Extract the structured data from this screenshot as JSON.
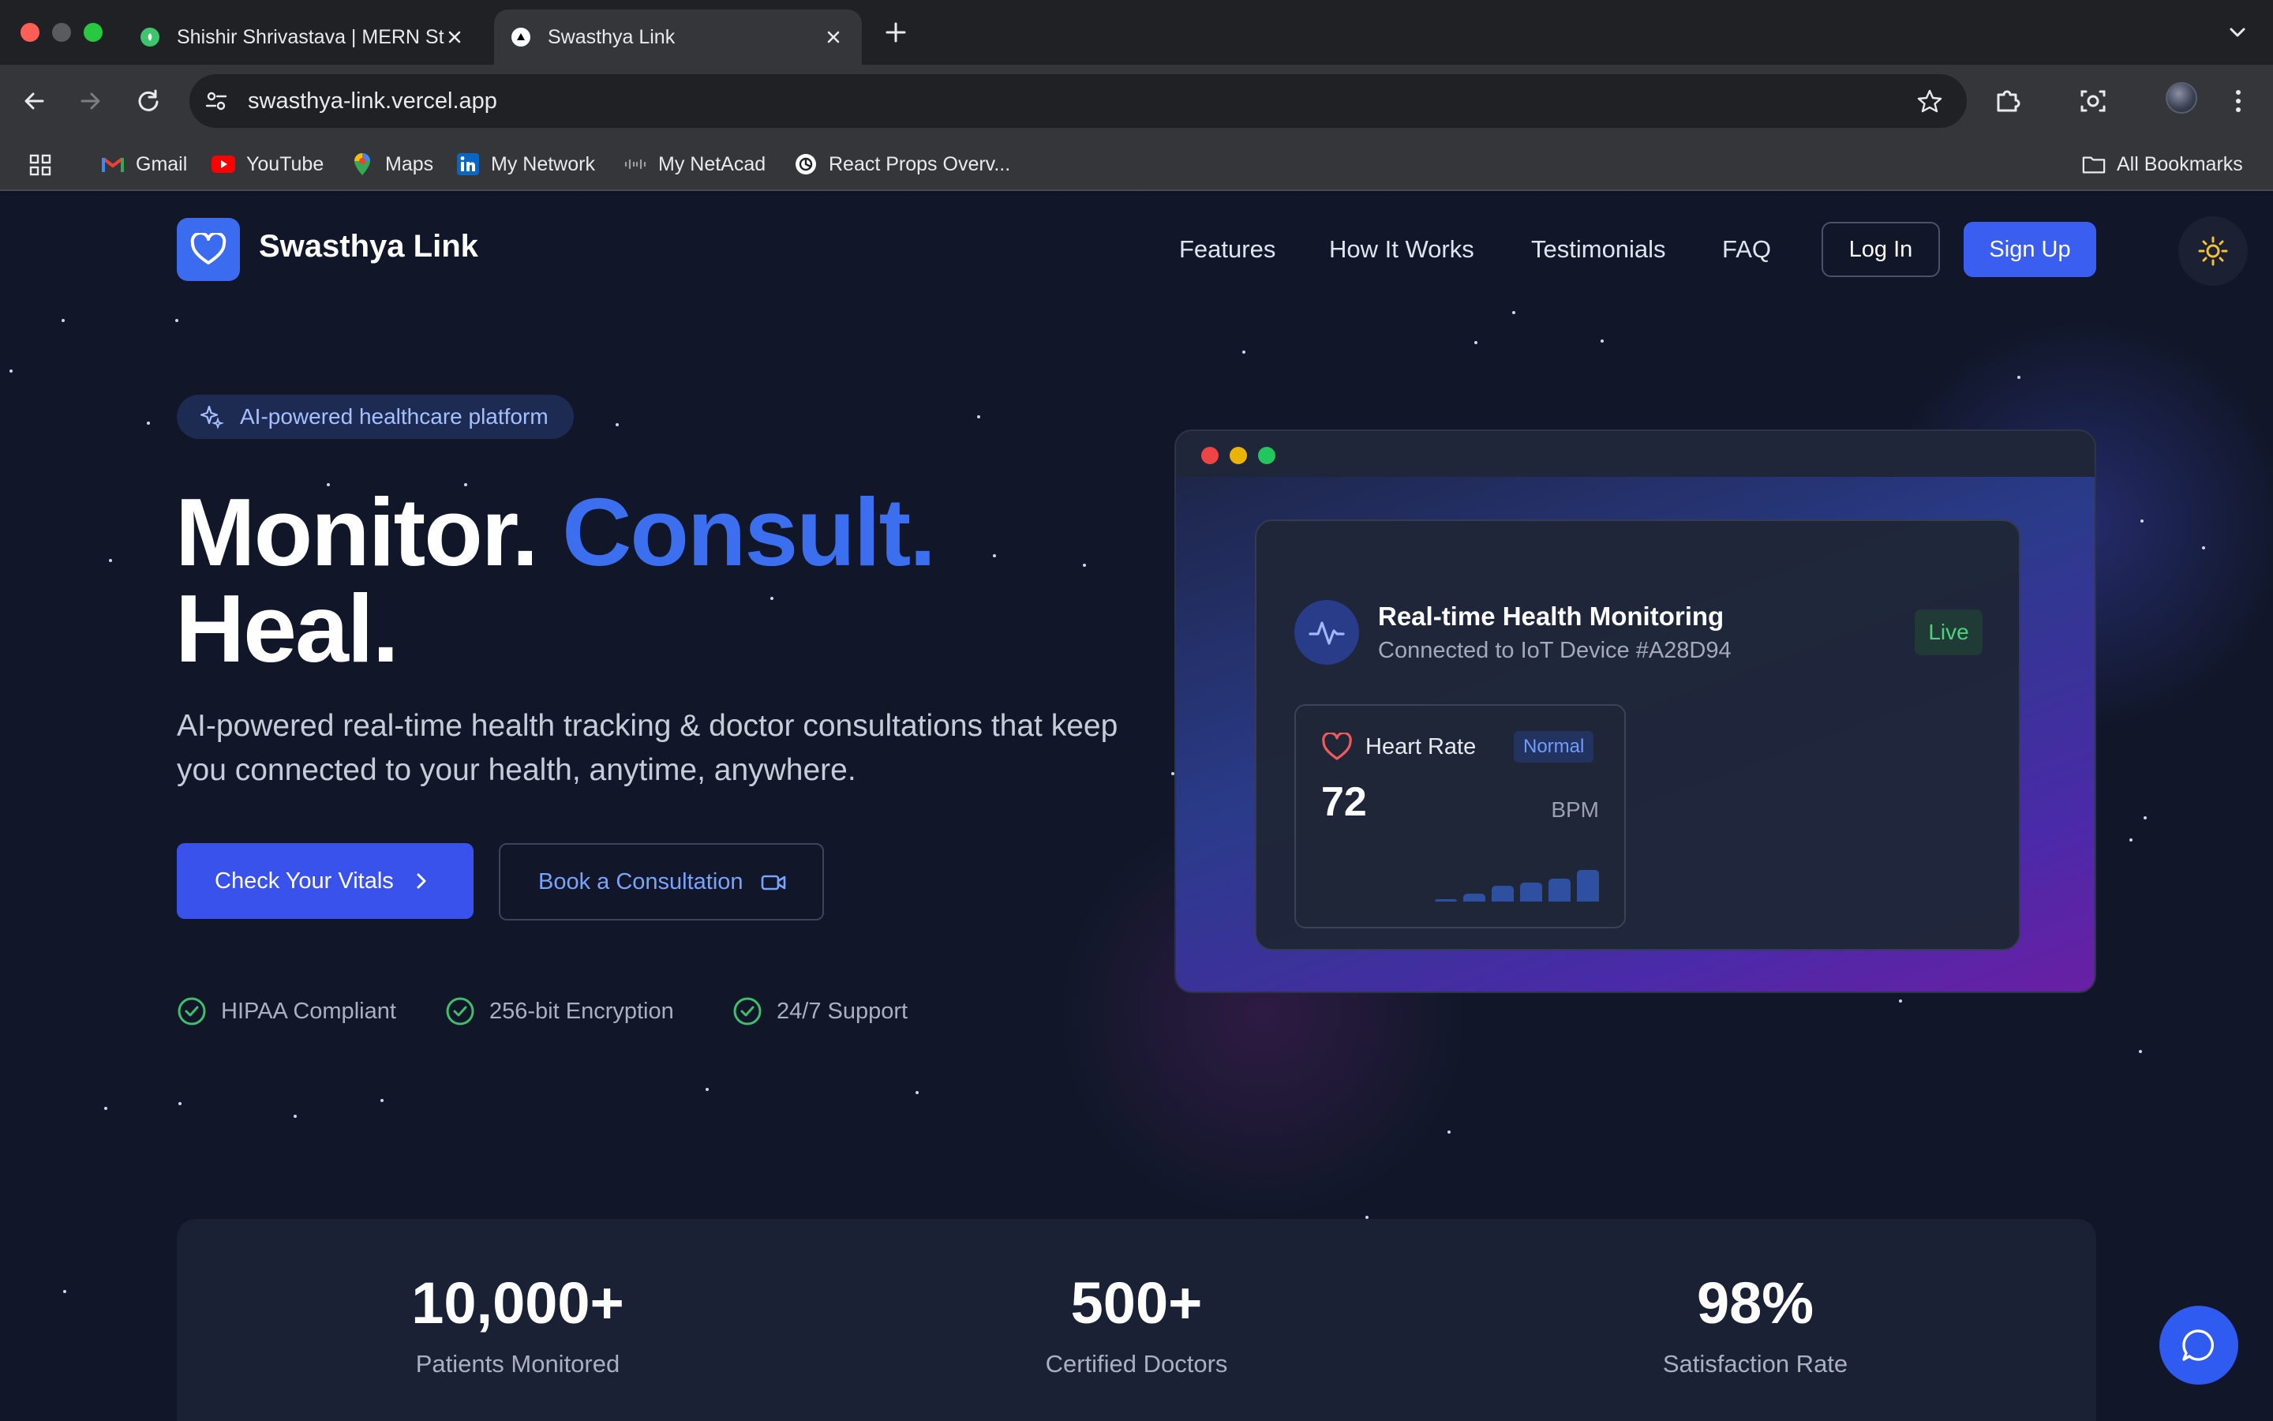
{
  "browser": {
    "tabs": [
      {
        "label": "Shishir Shrivastava | MERN St",
        "active": false,
        "icon": "green-leaf-favicon"
      },
      {
        "label": "Swasthya Link",
        "active": true,
        "icon": "triangle-favicon"
      }
    ],
    "url": "swasthya-link.vercel.app",
    "bookmarks": [
      {
        "label": "Gmail",
        "icon": "gmail-icon"
      },
      {
        "label": "YouTube",
        "icon": "youtube-icon"
      },
      {
        "label": "Maps",
        "icon": "maps-icon"
      },
      {
        "label": "My Network",
        "icon": "linkedin-icon"
      },
      {
        "label": "My NetAcad",
        "icon": "cisco-icon"
      },
      {
        "label": "React Props Overv...",
        "icon": "openai-icon"
      }
    ],
    "all_bookmarks": "All Bookmarks"
  },
  "site": {
    "brand": "Swasthya Link",
    "nav": {
      "features": "Features",
      "how": "How It Works",
      "testimonials": "Testimonials",
      "faq": "FAQ"
    },
    "login": "Log In",
    "signup": "Sign Up"
  },
  "hero": {
    "badge": "AI-powered healthcare platform",
    "h1_part1": "Monitor.",
    "h1_part2": "Consult.",
    "h1_part3": "Heal.",
    "lead": "AI-powered real-time health tracking & doctor consultations that keep you connected to your health, anytime, anywhere.",
    "cta_primary": "Check Your Vitals",
    "cta_secondary": "Book a Consultation",
    "trust": [
      "HIPAA Compliant",
      "256-bit Encryption",
      "24/7 Support"
    ]
  },
  "preview": {
    "title": "Real-time Health Monitoring",
    "subtitle": "Connected to IoT Device #A28D94",
    "status": "Live",
    "metric_label": "Heart Rate",
    "metric_status": "Normal",
    "metric_value": "72",
    "metric_unit": "BPM",
    "sparkline": [
      0.05,
      0.25,
      0.5,
      0.6,
      0.72,
      1.0
    ]
  },
  "stats": [
    {
      "value": "10,000+",
      "label": "Patients Monitored"
    },
    {
      "value": "500+",
      "label": "Certified Doctors"
    },
    {
      "value": "98%",
      "label": "Satisfaction Rate"
    }
  ],
  "colors": {
    "accent": "#3b6ff0",
    "background": "#111729",
    "live_green": "#4ed17e",
    "check_green": "#3fbf6a"
  }
}
